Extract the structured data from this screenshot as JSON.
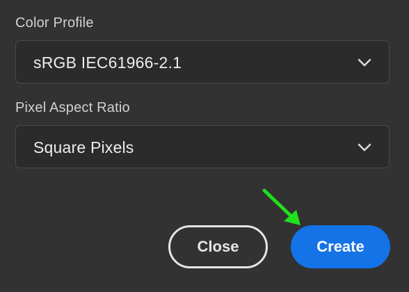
{
  "color_profile": {
    "label": "Color Profile",
    "value": "sRGB IEC61966-2.1"
  },
  "pixel_aspect_ratio": {
    "label": "Pixel Aspect Ratio",
    "value": "Square Pixels"
  },
  "buttons": {
    "close_label": "Close",
    "create_label": "Create"
  },
  "colors": {
    "background": "#323232",
    "field_background": "#2b2b2b",
    "primary_button": "#1473e6",
    "annotation_arrow": "#1fe01f"
  },
  "icons": {
    "dropdown": "chevron-down-icon",
    "annotation": "arrow-annotation-icon"
  }
}
